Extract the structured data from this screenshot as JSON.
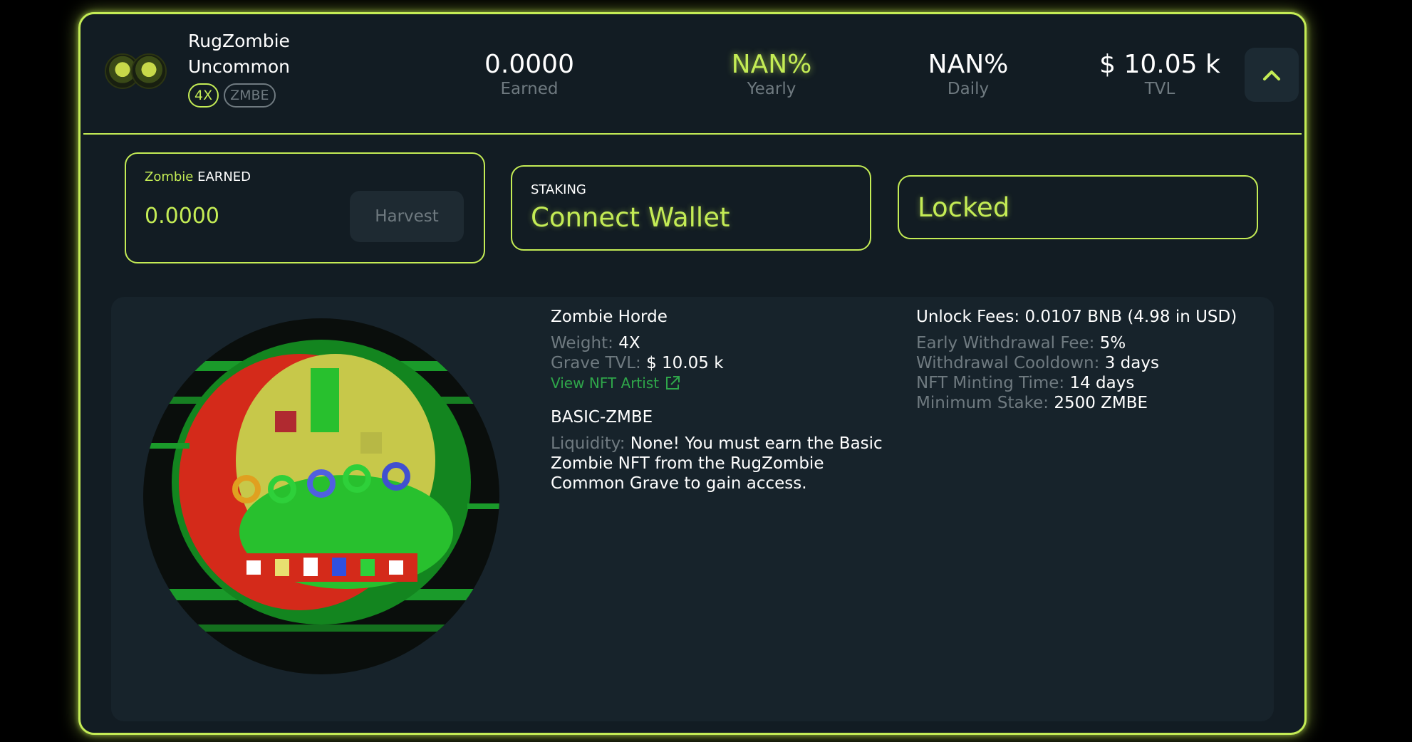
{
  "pool": {
    "name_line1": "RugZombie",
    "name_line2": "Uncommon",
    "tag_multiplier": "4X",
    "tag_token": "ZMBE"
  },
  "stats": {
    "earned": {
      "value": "0.0000",
      "label": "Earned"
    },
    "yearly": {
      "value": "NAN%",
      "label": "Yearly"
    },
    "daily": {
      "value": "NAN%",
      "label": "Daily"
    },
    "tvl": {
      "value": "$ 10.05 k",
      "label": "TVL"
    }
  },
  "earned_box": {
    "token": "Zombie",
    "label": "EARNED",
    "amount": "0.0000",
    "harvest_label": "Harvest"
  },
  "staking_box": {
    "label": "STAKING",
    "action": "Connect Wallet"
  },
  "locked_box": {
    "text": "Locked"
  },
  "details": {
    "nft_name": "Zombie Horde",
    "weight_label": "Weight:",
    "weight_value": "4X",
    "grave_tvl_label": "Grave TVL:",
    "grave_tvl_value": "$ 10.05 k",
    "nft_artist_link": "View NFT Artist",
    "requirement_name": "BASIC-ZMBE",
    "liquidity_label": "Liquidity:",
    "liquidity_value": "None! You must earn the Basic Zombie NFT from the RugZombie Common Grave to gain access.",
    "unlock_fees": "Unlock Fees: 0.0107 BNB (4.98 in USD)",
    "early_withdrawal_label": "Early Withdrawal Fee:",
    "early_withdrawal_value": "5%",
    "cooldown_label": "Withdrawal Cooldown:",
    "cooldown_value": "3 days",
    "minting_label": "NFT Minting Time:",
    "minting_value": "14 days",
    "min_stake_label": "Minimum Stake:",
    "min_stake_value": "2500 ZMBE"
  },
  "icons": {
    "collapse": "chevron-up-icon",
    "external_link": "external-link-icon",
    "pool": "zombie-token-icon",
    "nft_art": "zombie-skull-nft-image"
  },
  "colors": {
    "accent": "#c4ec55",
    "background": "#121c23",
    "panel": "#17232b",
    "muted": "#6f7a80",
    "link": "#2fa64a"
  }
}
